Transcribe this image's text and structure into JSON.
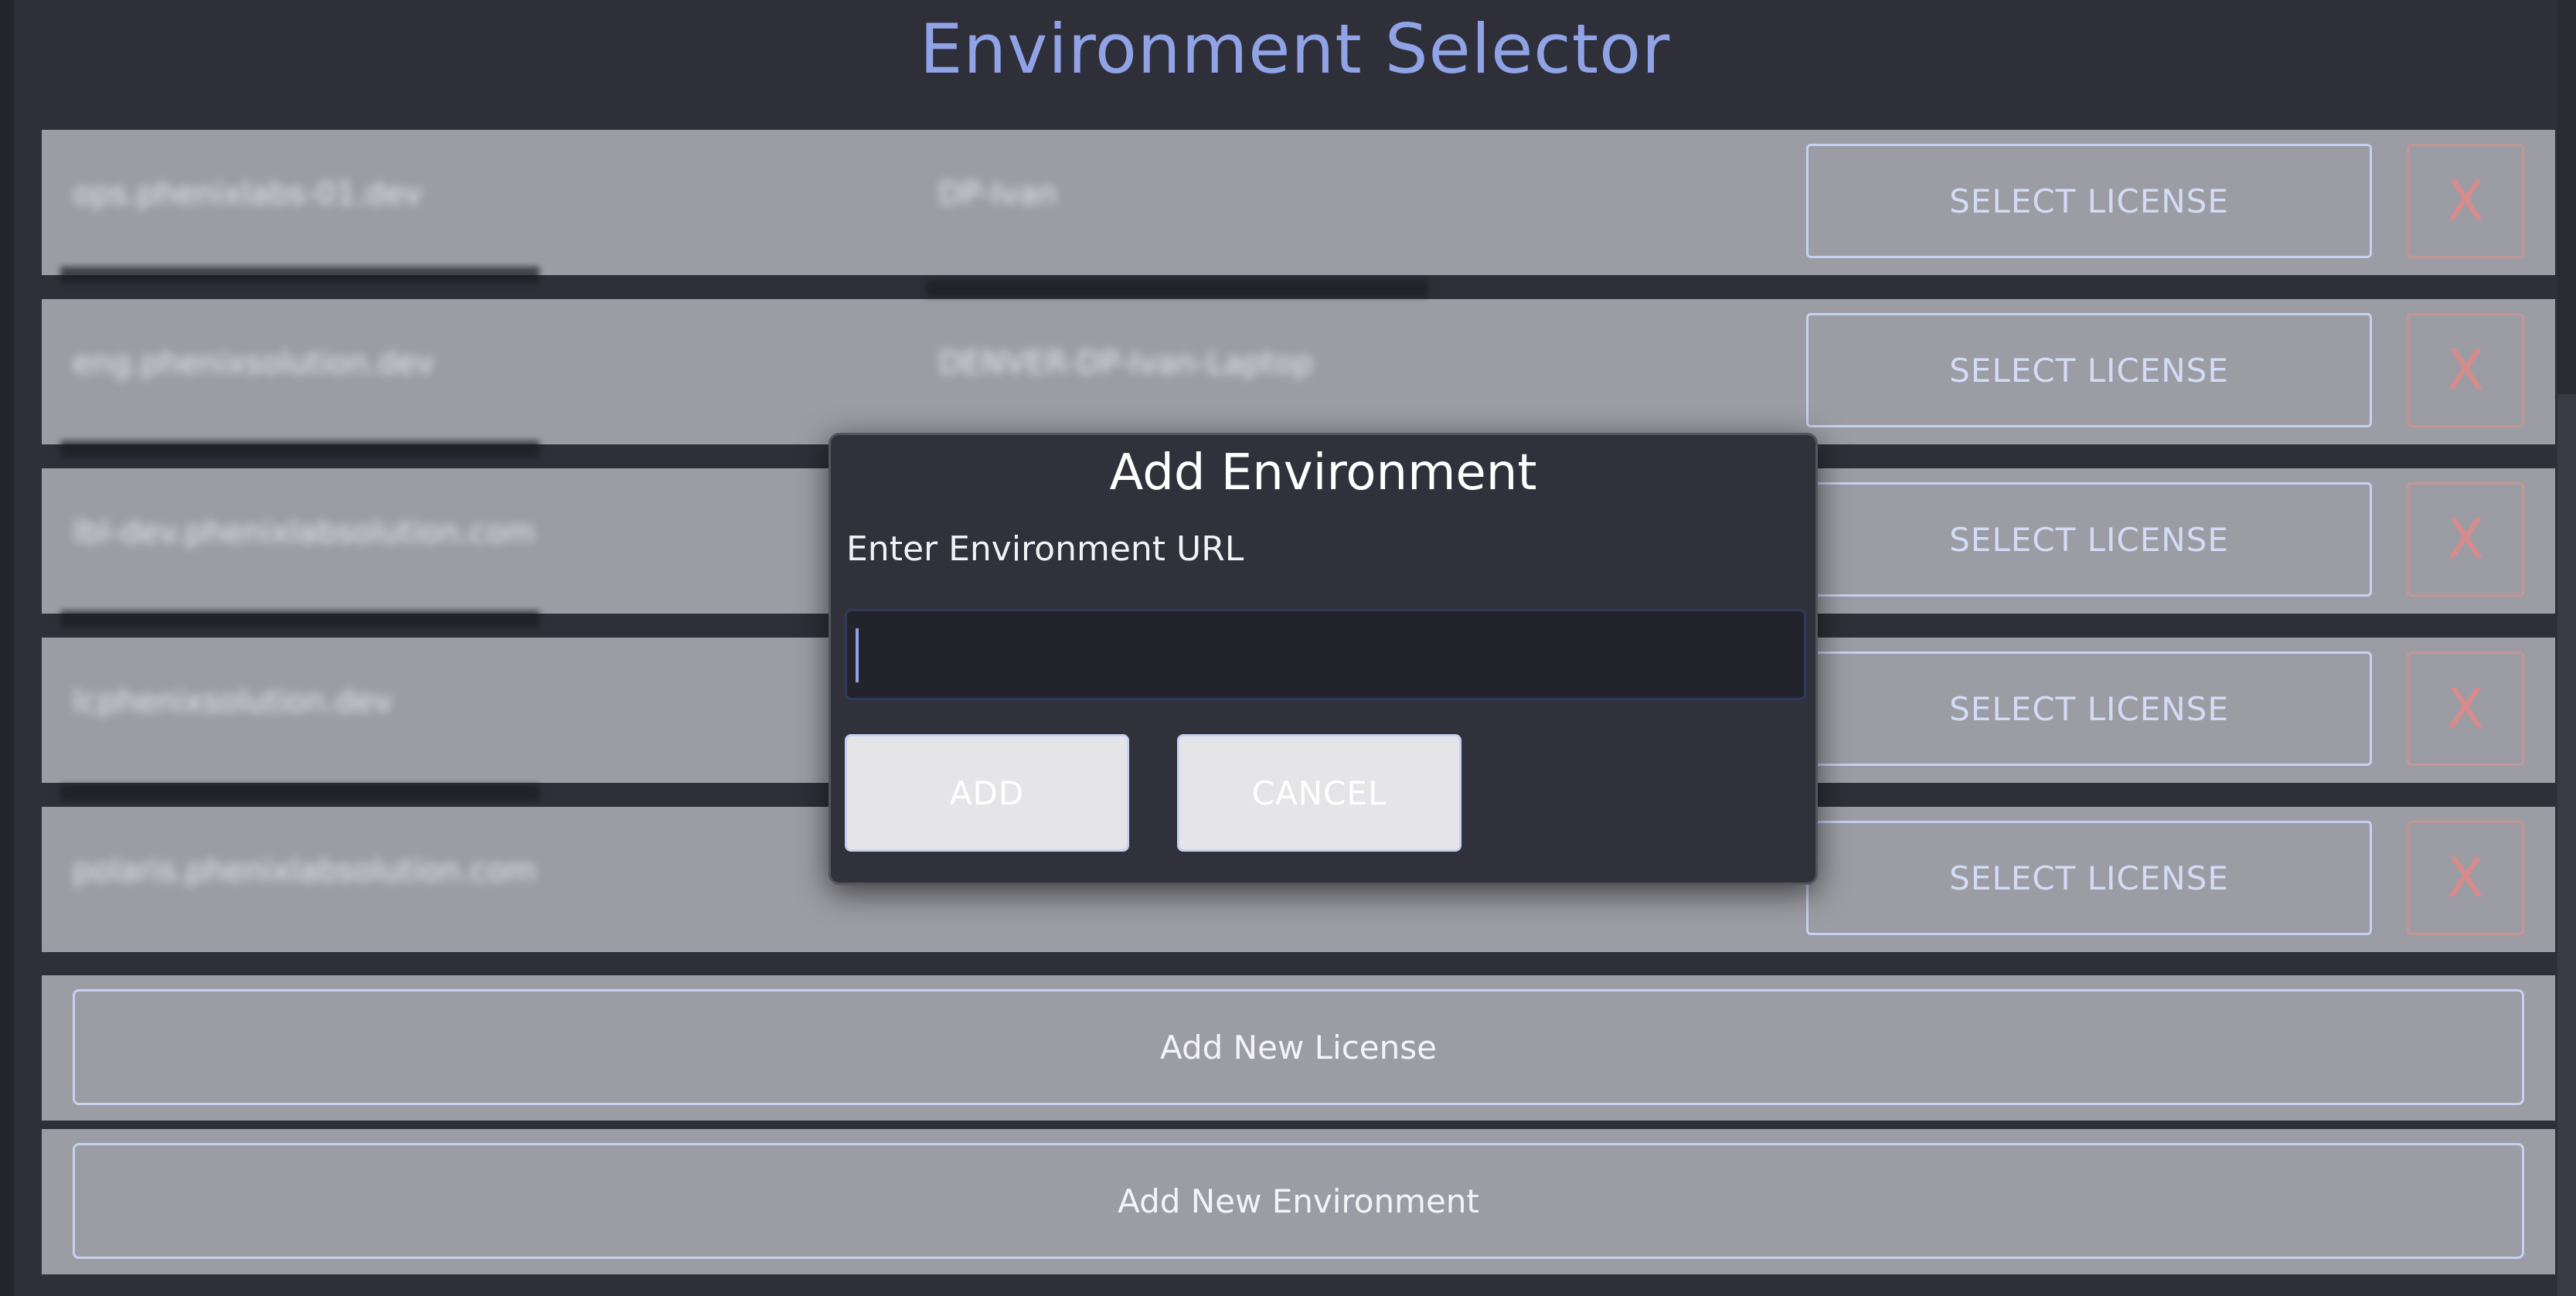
{
  "window": {
    "title": "Environment Selector"
  },
  "environments": [
    {
      "url": "ops.phenixlabs-01.dev",
      "name": "DP-Ivan",
      "select_label": "SELECT LICENSE",
      "remove_label": "X"
    },
    {
      "url": "eng.phenixsolution.dev",
      "name": "DENVER-DP-Ivan-Laptop",
      "select_label": "SELECT LICENSE",
      "remove_label": "X"
    },
    {
      "url": "lbl-dev.phenixlabsolution.com",
      "name": "",
      "select_label": "SELECT LICENSE",
      "remove_label": "X"
    },
    {
      "url": "lcphenixsolution.dev",
      "name": "",
      "select_label": "SELECT LICENSE",
      "remove_label": "X"
    },
    {
      "url": "polaris.phenixlabsolution.com",
      "name": "",
      "select_label": "SELECT LICENSE",
      "remove_label": "X"
    }
  ],
  "actions": {
    "add_license": "Add New License",
    "add_environment": "Add New Environment"
  },
  "modal": {
    "title": "Add Environment",
    "label": "Enter Environment URL",
    "input_value": "",
    "input_placeholder": "",
    "add_label": "ADD",
    "cancel_label": "CANCEL"
  },
  "colors": {
    "title": "#8fa3e6",
    "background": "#2f2f39",
    "row": "#9c9ca4",
    "button_border": "#c6d2f2",
    "remove_border": "#c49696",
    "modal_bg": "#31313c"
  }
}
